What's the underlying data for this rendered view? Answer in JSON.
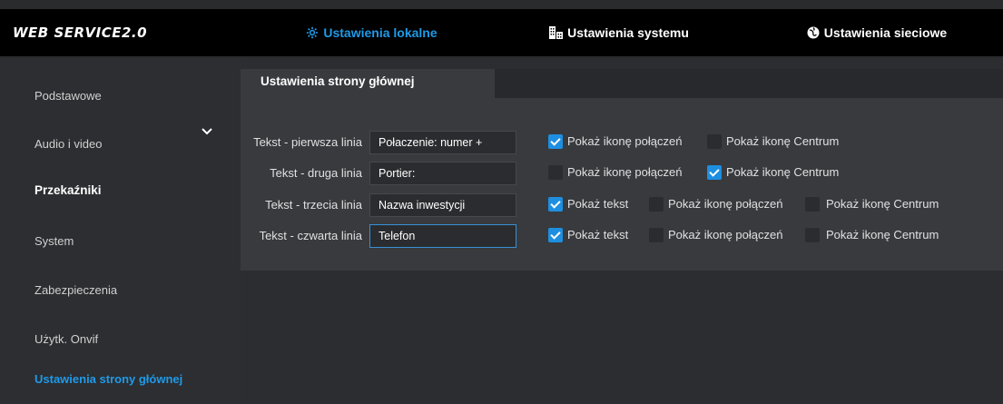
{
  "app": {
    "logo": "WEB SERVICE2.0"
  },
  "nav": {
    "tabs": [
      {
        "label": "Ustawienia lokalne",
        "icon": "gear-icon",
        "active": true
      },
      {
        "label": "Ustawienia systemu",
        "icon": "building-icon",
        "active": false
      },
      {
        "label": "Ustawienia sieciowe",
        "icon": "globe-icon",
        "active": false
      }
    ]
  },
  "sidebar": {
    "items": [
      {
        "label": "Podstawowe"
      },
      {
        "label": "Audio i video"
      },
      {
        "label": "Przekaźniki",
        "expandable": true
      },
      {
        "label": "System"
      },
      {
        "label": "Zabezpieczenia"
      },
      {
        "label": "Użytk. Onvif"
      },
      {
        "label": "Ustawienia strony głównej",
        "active": true
      }
    ]
  },
  "panel": {
    "tab_label": "Ustawienia strony głównej",
    "rows": [
      {
        "label": "Tekst - pierwsza linia",
        "value": "Połaczenie: numer +",
        "options": [
          {
            "label": "Pokaż ikonę połączeń",
            "checked": true
          },
          {
            "label": "Pokaż ikonę Centrum",
            "checked": false
          }
        ]
      },
      {
        "label": "Tekst - druga linia",
        "value": "Portier:",
        "options": [
          {
            "label": "Pokaż ikonę połączeń",
            "checked": false
          },
          {
            "label": "Pokaż ikonę Centrum",
            "checked": true
          }
        ]
      },
      {
        "label": "Tekst - trzecia linia",
        "value": "Nazwa inwestycji",
        "options": [
          {
            "label": "Pokaż tekst",
            "checked": true
          },
          {
            "label": "Pokaż ikonę połączeń",
            "checked": false
          },
          {
            "label": "Pokaż ikonę Centrum",
            "checked": false
          }
        ]
      },
      {
        "label": "Tekst - czwarta linia",
        "value": "Telefon",
        "focused": true,
        "options": [
          {
            "label": "Pokaż tekst",
            "checked": true
          },
          {
            "label": "Pokaż ikonę połączeń",
            "checked": false
          },
          {
            "label": "Pokaż ikonę Centrum",
            "checked": false
          }
        ]
      }
    ]
  },
  "colors": {
    "accent": "#1f9ae8",
    "checkbox": "#1e8fe0",
    "background": "#2b2d30",
    "panel": "#383a3e"
  }
}
